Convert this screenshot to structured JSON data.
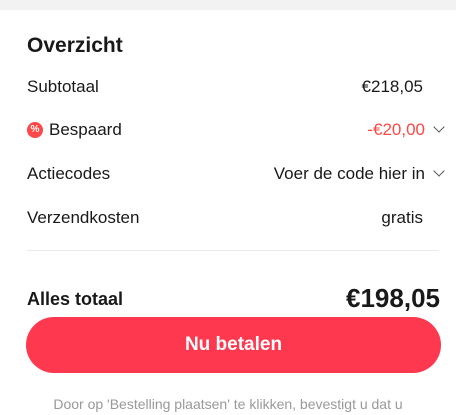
{
  "summary": {
    "title": "Overzicht",
    "subtotal_label": "Subtotaal",
    "subtotal_value": "€218,05",
    "savings_badge": "%",
    "savings_label": "Bespaard",
    "savings_value": "-€20,00",
    "promo_label": "Actiecodes",
    "promo_value": "Voer de code hier in",
    "shipping_label": "Verzendkosten",
    "shipping_value": "gratis",
    "total_label": "Alles totaal",
    "total_value": "€198,05"
  },
  "pay_button_label": "Nu betalen",
  "disclaimer": "Door op 'Bestelling plaatsen' te klikken, bevestigt u dat u",
  "colors": {
    "accent": "#fd384f",
    "saving": "#ff4747"
  }
}
